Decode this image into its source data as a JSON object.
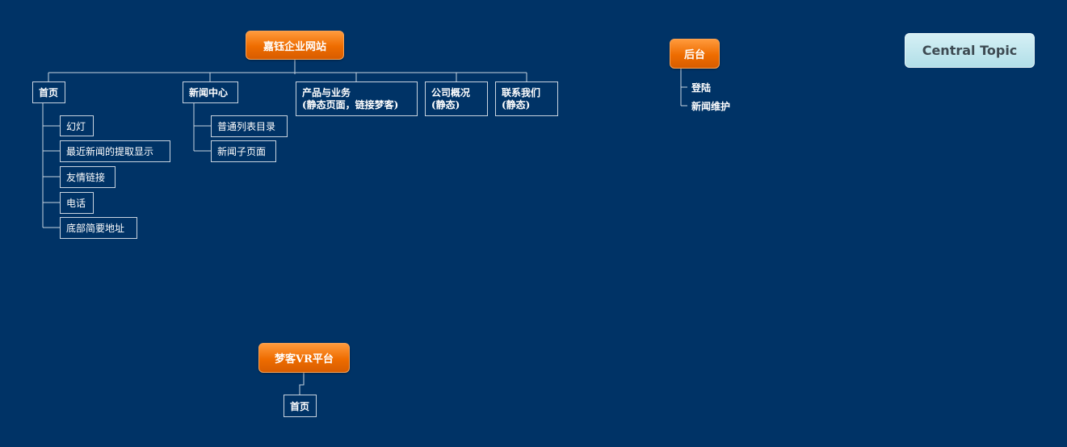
{
  "diagram": {
    "background": "#003366",
    "root_color": "#ee6c00",
    "line_color": "#c9d4e0",
    "central_topic": "Central Topic",
    "main": {
      "title": "嘉钰企业网站",
      "home": {
        "label": "首页",
        "children": [
          "幻灯",
          "最近新闻的提取显示",
          "友情链接",
          "电话",
          "底部简要地址"
        ]
      },
      "news": {
        "label": "新闻中心",
        "children": [
          "普通列表目录",
          "新闻子页面"
        ]
      },
      "products": {
        "line1": "产品与业务",
        "line2": "(静态页面，链接梦客)"
      },
      "company": {
        "line1": "公司概况",
        "line2": "(静态)"
      },
      "contact": {
        "line1": "联系我们",
        "line2": "(静态)"
      }
    },
    "backend": {
      "title": "后台",
      "children": [
        "登陆",
        "新闻维护"
      ]
    },
    "vr": {
      "title": "梦客VR平台",
      "children": [
        "首页"
      ]
    }
  }
}
